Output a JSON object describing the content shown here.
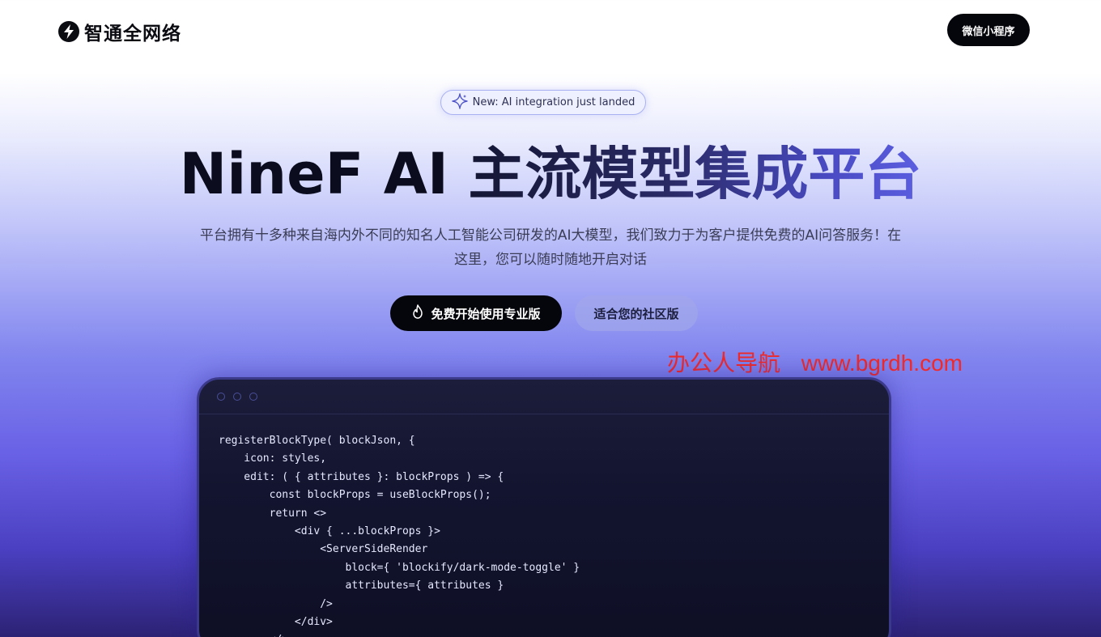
{
  "brand": {
    "name": "智通全网络"
  },
  "nav": {
    "mini_program_label": "微信小程序"
  },
  "announcement": {
    "text": "New: AI integration just landed"
  },
  "hero": {
    "title_part1": "NineF AI ",
    "title_part2": "主流模型集成平台",
    "subtitle": "平台拥有十多种来自海内外不同的知名人工智能公司研发的AI大模型，我们致力于为客户提供免费的AI问答服务！在这里，您可以随时随地开启对话"
  },
  "cta": {
    "primary_label": "免费开始使用专业版",
    "secondary_label": "适合您的社区版"
  },
  "watermark": {
    "cn": "办公人导航",
    "url": "www.bgrdh.com"
  },
  "code": {
    "lines": [
      "registerBlockType( blockJson, {",
      "    icon: styles,",
      "    edit: ( { attributes }: blockProps ) => {",
      "        const blockProps = useBlockProps();",
      "        return <>",
      "            <div { ...blockProps }>",
      "                <ServerSideRender",
      "                    block={ 'blockify/dark-mode-toggle' }",
      "                    attributes={ attributes }",
      "                />",
      "            </div>",
      "        </>;"
    ]
  },
  "colors": {
    "primary_dark": "#05060c",
    "accent": "#5b5ee0",
    "watermark": "#f02a2a"
  },
  "icons": {
    "logo": "lightning-bolt-icon",
    "announcement": "sparkle-icon",
    "cta_primary": "flame-icon"
  }
}
